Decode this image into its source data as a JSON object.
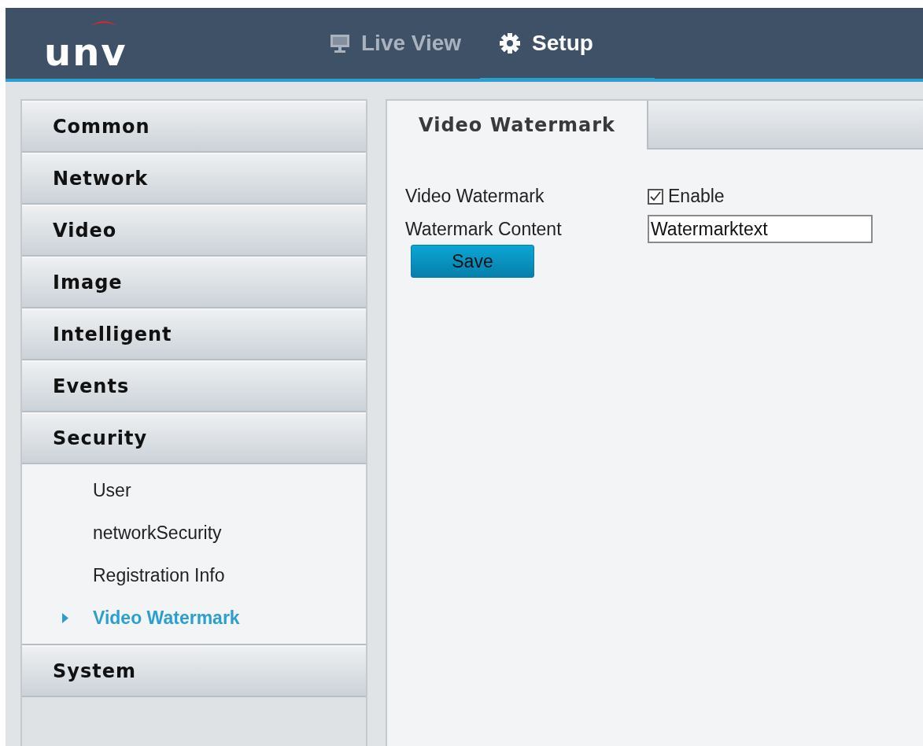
{
  "header": {
    "logo": "unv",
    "nav": [
      {
        "label": "Live View",
        "selected": false
      },
      {
        "label": "Setup",
        "selected": true
      }
    ]
  },
  "sidebar": {
    "sections": [
      {
        "label": "Common"
      },
      {
        "label": "Network"
      },
      {
        "label": "Video"
      },
      {
        "label": "Image"
      },
      {
        "label": "Intelligent"
      },
      {
        "label": "Events"
      },
      {
        "label": "Security",
        "children": [
          {
            "label": "User",
            "selected": false
          },
          {
            "label": "networkSecurity",
            "selected": false
          },
          {
            "label": "Registration Info",
            "selected": false
          },
          {
            "label": "Video Watermark",
            "selected": true
          }
        ]
      },
      {
        "label": "System"
      }
    ]
  },
  "content": {
    "tabs": [
      {
        "label": "Video Watermark",
        "selected": true
      }
    ],
    "form": [
      {
        "kind": "checkbox",
        "label": "Video Watermark",
        "option": "Enable",
        "checked": true
      },
      {
        "kind": "text",
        "label": "Watermark Content",
        "value": "Watermarktext"
      }
    ],
    "buttons": [
      "Save"
    ]
  }
}
